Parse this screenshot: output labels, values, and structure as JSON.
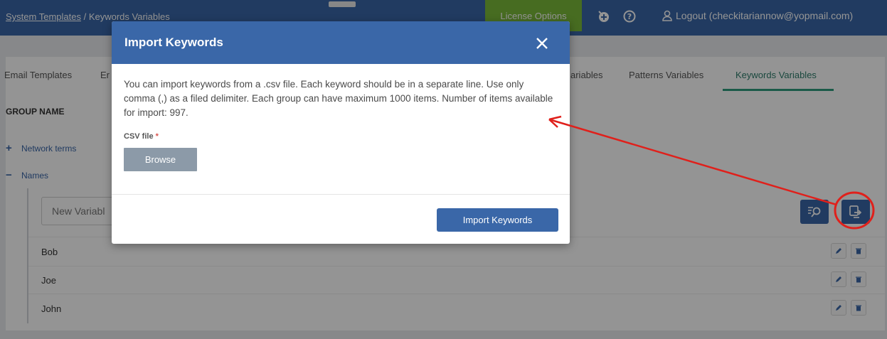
{
  "header": {
    "breadcrumb_link": "System Templates",
    "breadcrumb_sep": " / ",
    "breadcrumb_current": "Keywords Variables",
    "license_label": "License Options",
    "logout_label": "Logout (checkitariannow@yopmail.com)"
  },
  "tabs": [
    {
      "label": "Email Templates"
    },
    {
      "label": "Er"
    },
    {
      "label": "ariables"
    },
    {
      "label": "Patterns Variables"
    },
    {
      "label": "Keywords Variables"
    }
  ],
  "group_header": "GROUP NAME",
  "groups": [
    {
      "symbol": "+",
      "label": "Network terms"
    },
    {
      "symbol": "−",
      "label": "Names"
    }
  ],
  "new_variable_placeholder": "New Variabl",
  "keywords": [
    "Bob",
    "Joe",
    "John"
  ],
  "modal": {
    "title": "Import Keywords",
    "description": "You can import keywords from a .csv file. Each keyword should be in a separate line. Use only comma (,) as a filed delimiter. Each group can have maximum 1000 items. Number of items available for import: 997.",
    "csv_label": "CSV file",
    "required_mark": " *",
    "browse_label": "Browse",
    "import_label": "Import Keywords"
  },
  "colors": {
    "brand_blue": "#3a67a8",
    "license_green": "#7aba3a",
    "annotation_red": "#e0201b"
  }
}
